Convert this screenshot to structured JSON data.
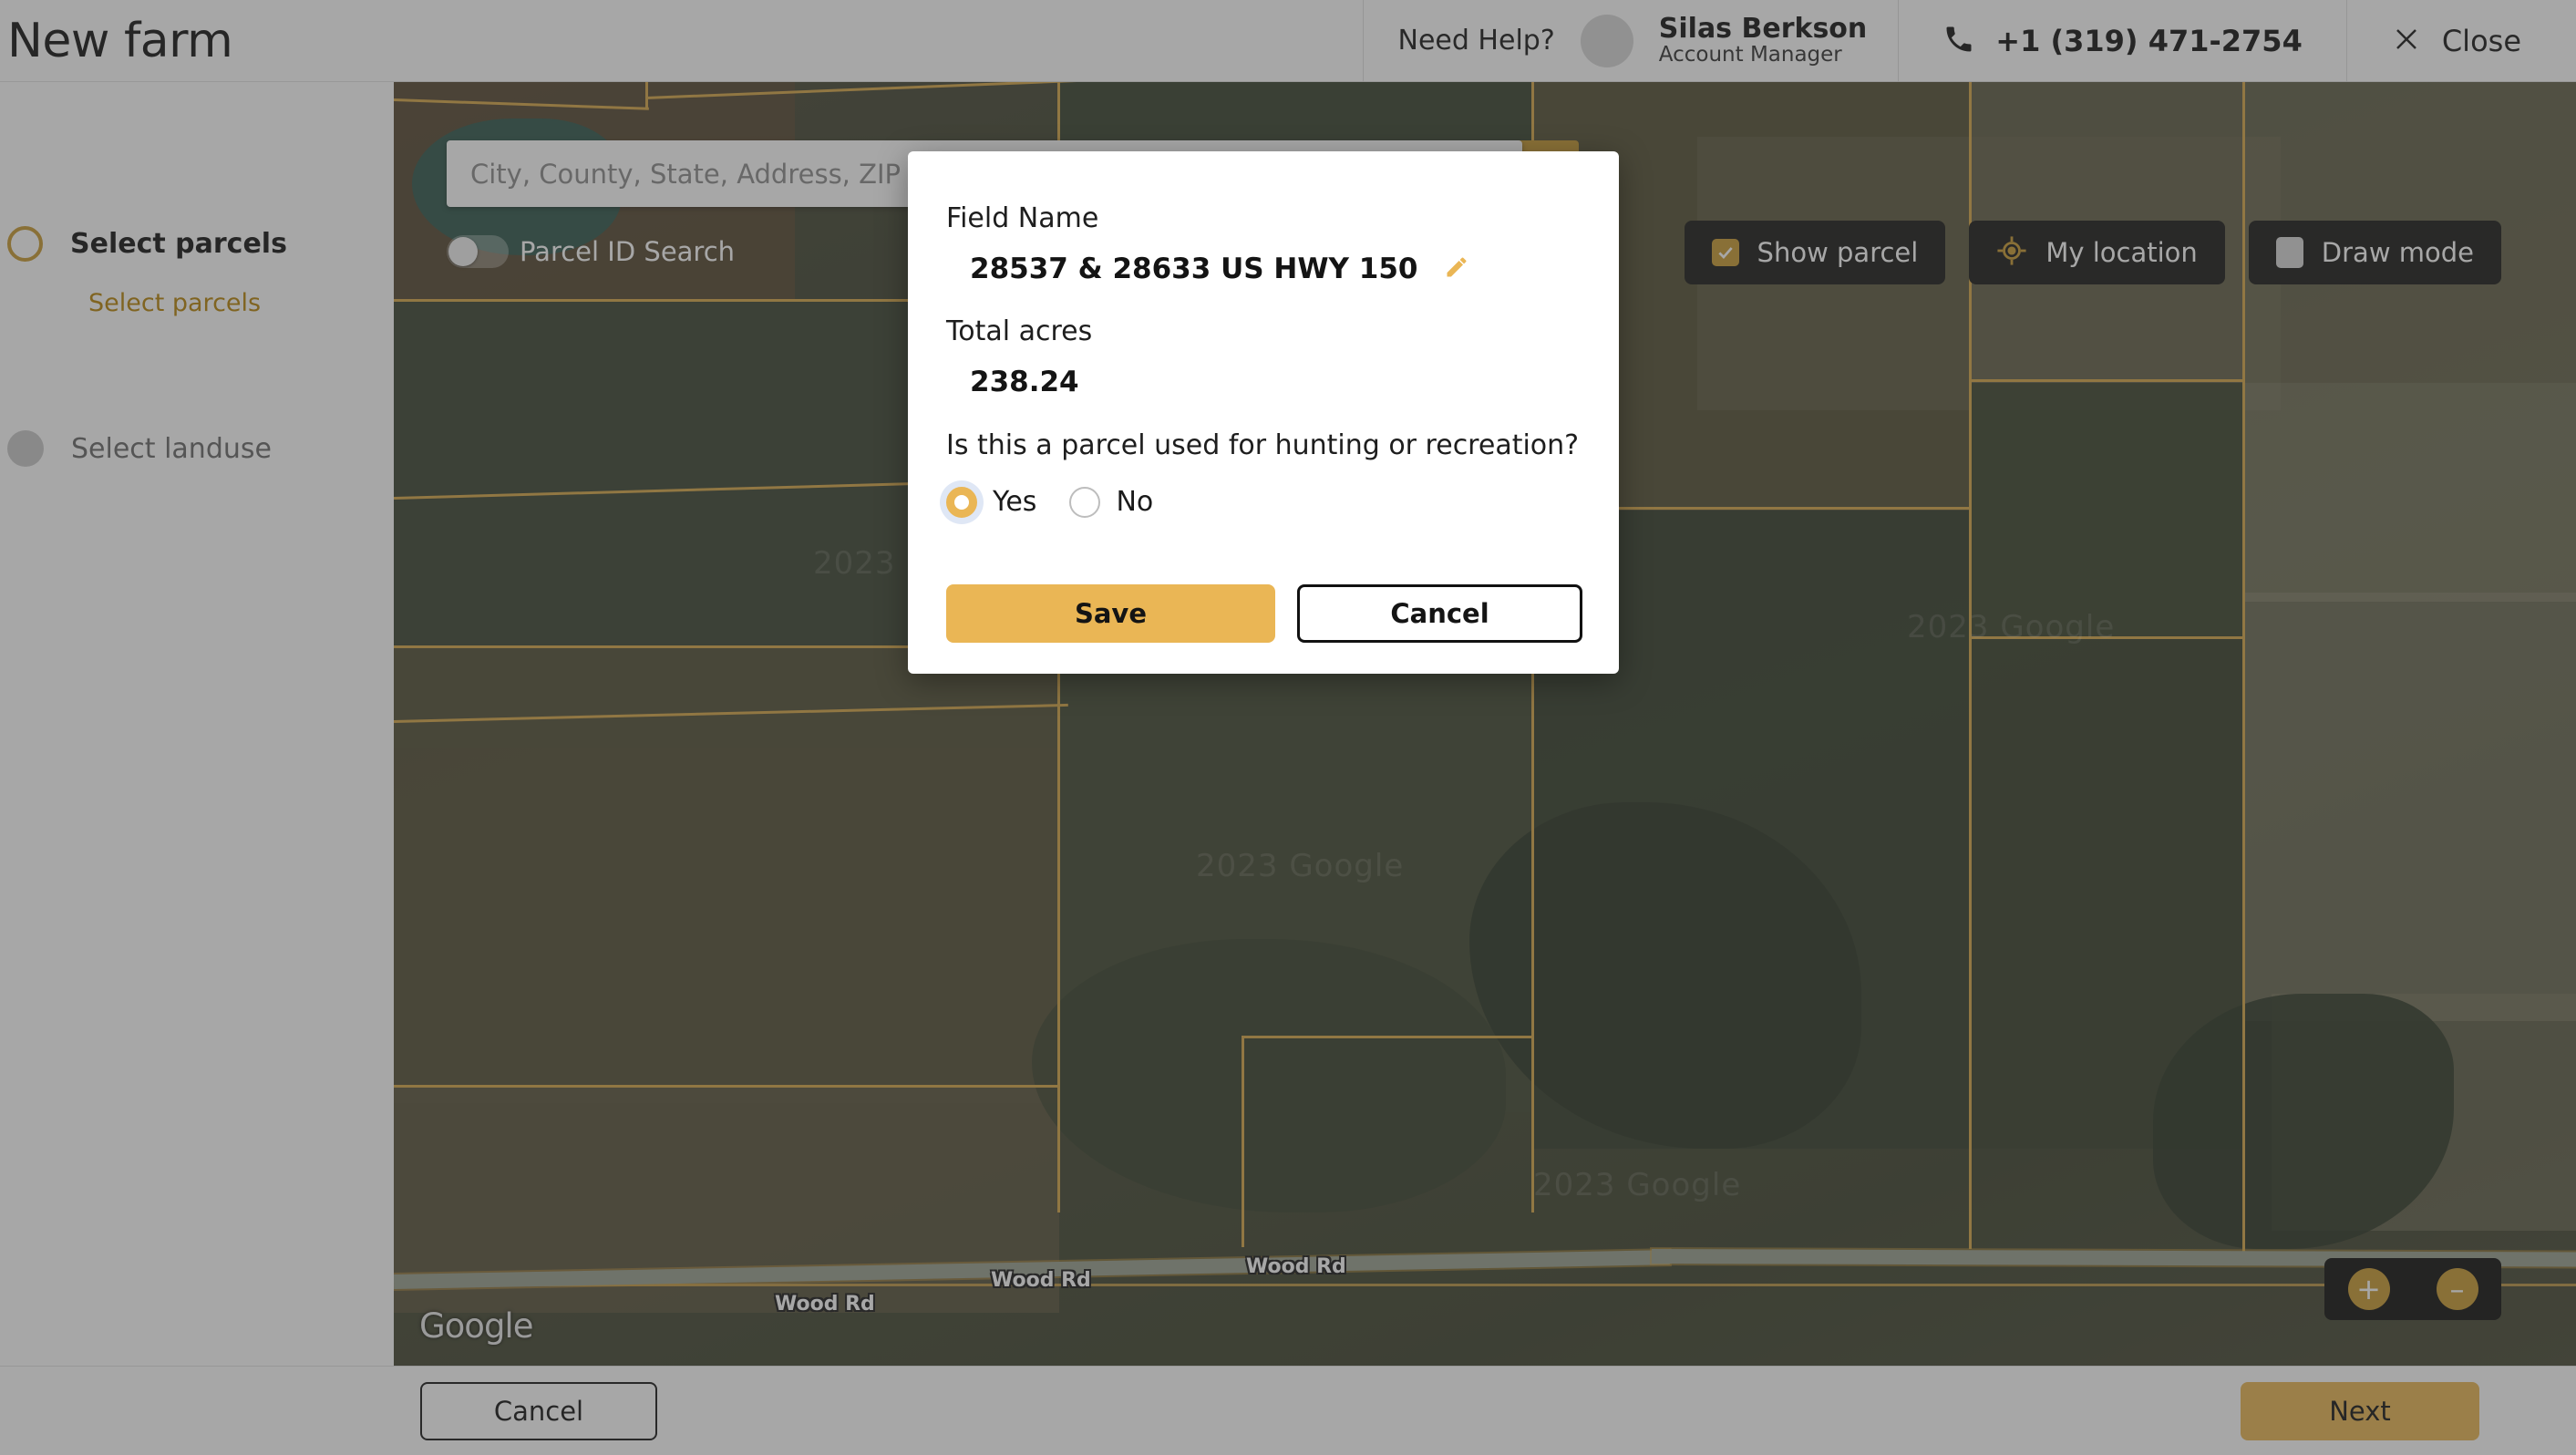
{
  "header": {
    "title": "New farm",
    "need_help_label": "Need Help?",
    "account_name": "Silas Berkson",
    "account_role": "Account Manager",
    "phone": "+1 (319) 471-2754",
    "close_label": "Close",
    "avatar_icon": "avatar-placeholder-icon",
    "phone_icon": "phone-icon",
    "close_icon": "close-x-icon"
  },
  "sidebar": {
    "steps": [
      {
        "label": "Select parcels",
        "state": "active"
      },
      {
        "label": "Select landuse",
        "state": "idle"
      }
    ],
    "substep": "Select parcels"
  },
  "map": {
    "search_placeholder": "City, County, State, Address, ZIP",
    "search_value": "",
    "search_icon": "search-icon",
    "parcel_id_toggle_label": "Parcel ID Search",
    "parcel_id_toggle_state": "off",
    "toolbar": [
      {
        "label": "Show parcel",
        "icon": "checkbox-checked-icon",
        "state": "on"
      },
      {
        "label": "My location",
        "icon": "crosshair-target-icon",
        "state": "off"
      },
      {
        "label": "Draw mode",
        "icon": "checkbox-unchecked-icon",
        "state": "off"
      }
    ],
    "zoom_in_label": "+",
    "zoom_out_label": "–",
    "attribution": "Google",
    "watermarks": [
      "2023 Google",
      "2023 Google",
      "2023 Google",
      "2023 Google",
      "2023 Google"
    ],
    "road_labels": [
      "Wood Rd",
      "Wood Rd",
      "Wood Rd"
    ]
  },
  "modal": {
    "field_name_label": "Field Name",
    "field_name_value": "28537 & 28633 US HWY 150",
    "edit_icon": "pencil-edit-icon",
    "total_acres_label": "Total acres",
    "total_acres_value": "238.24",
    "question": "Is this a parcel used for hunting or recreation?",
    "options": [
      {
        "label": "Yes",
        "selected": true
      },
      {
        "label": "No",
        "selected": false
      }
    ],
    "save_label": "Save",
    "cancel_label": "Cancel"
  },
  "footer": {
    "cancel_label": "Cancel",
    "next_label": "Next"
  },
  "colors": {
    "accent_gold": "#eab655",
    "accent_gold_dark": "#c99b33",
    "step_active": "#b8860b",
    "toolbar_dark": "#1b1b18"
  }
}
